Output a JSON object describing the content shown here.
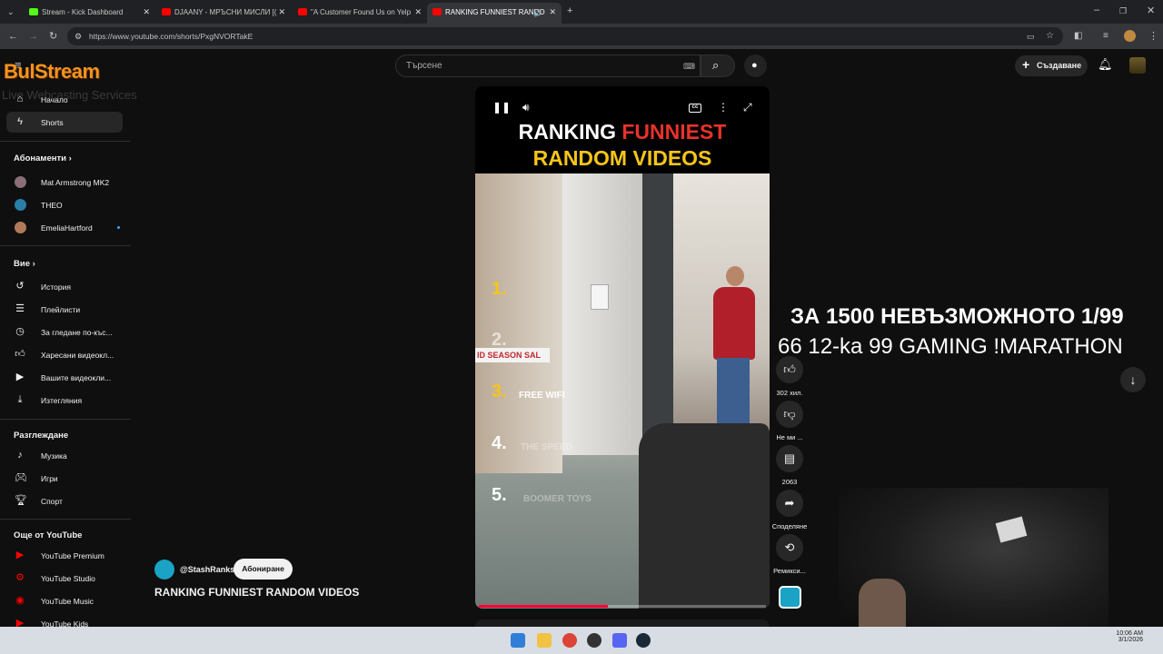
{
  "browser": {
    "tabs": [
      {
        "title": "Stream - Kick Dashboard"
      },
      {
        "title": "DJAANY - МРЪСНИ МИСЛИ [("
      },
      {
        "title": "\"A Customer Found Us on Yelp"
      },
      {
        "title": "RANKING FUNNIEST RANDO"
      }
    ],
    "url": "https://www.youtube.com/shorts/PxgNVORTakE"
  },
  "overlay_logo": {
    "brand": "BulStream",
    "tagline": "Live Webcasting Services"
  },
  "header": {
    "search_placeholder": "Търсене",
    "create_label": "Създаване"
  },
  "sidebar": {
    "main": [
      {
        "label": "Начало",
        "icon": "home-icon"
      },
      {
        "label": "Shorts",
        "icon": "shorts-icon"
      }
    ],
    "subscriptions_title": "Абонаменти",
    "subscriptions": [
      {
        "label": "Mat Armstrong MK2"
      },
      {
        "label": "THEO"
      },
      {
        "label": "EmeliaHartford"
      }
    ],
    "you_title": "Вие",
    "you": [
      {
        "label": "История",
        "icon": "history-icon"
      },
      {
        "label": "Плейлисти",
        "icon": "playlist-icon"
      },
      {
        "label": "За гледане по-къс...",
        "icon": "clock-icon"
      },
      {
        "label": "Харесани видеокл...",
        "icon": "like-icon"
      },
      {
        "label": "Вашите видеокли...",
        "icon": "video-icon"
      },
      {
        "label": "Изтегляния",
        "icon": "download-icon"
      }
    ],
    "explore_title": "Разглеждане",
    "explore": [
      {
        "label": "Музика",
        "icon": "music-icon"
      },
      {
        "label": "Игри",
        "icon": "gaming-icon"
      },
      {
        "label": "Спорт",
        "icon": "trophy-icon"
      }
    ],
    "more_title": "Още от YouTube",
    "more": [
      {
        "label": "YouTube Premium"
      },
      {
        "label": "YouTube Studio"
      },
      {
        "label": "YouTube Music"
      },
      {
        "label": "YouTube Kids"
      }
    ]
  },
  "video": {
    "title_line1_white": "RANKING",
    "title_line1_red": "FUNNIEST",
    "title_line2": "RANDOM VIDEOS",
    "ranks": [
      {
        "num": "1.",
        "label": ""
      },
      {
        "num": "2.",
        "label": "ID SEASON SAL"
      },
      {
        "num": "3.",
        "label": "FREE WIFI"
      },
      {
        "num": "4.",
        "label": "THE SPEED"
      },
      {
        "num": "5.",
        "label": "BOOMER TOYS"
      }
    ],
    "progress_fraction": 0.45
  },
  "actions": {
    "likes": "302 хил.",
    "dislike": "Не ми ...",
    "comments": "2063",
    "share": "Споделяне",
    "remix": "Ремикси..."
  },
  "channel": {
    "handle": "@StashRanks",
    "subscribe_label": "Абониране",
    "video_title": "RANKING FUNNIEST RANDOM VIDEOS"
  },
  "stream_overlay": {
    "line1": "ЗА 1500 НЕВЪЗМОЖНОТО 1/99",
    "line2": "66 12-ka 99 GAMING !MARATHON"
  },
  "taskbar": {
    "time": "10:06 AM",
    "date": "3/1/2026"
  }
}
